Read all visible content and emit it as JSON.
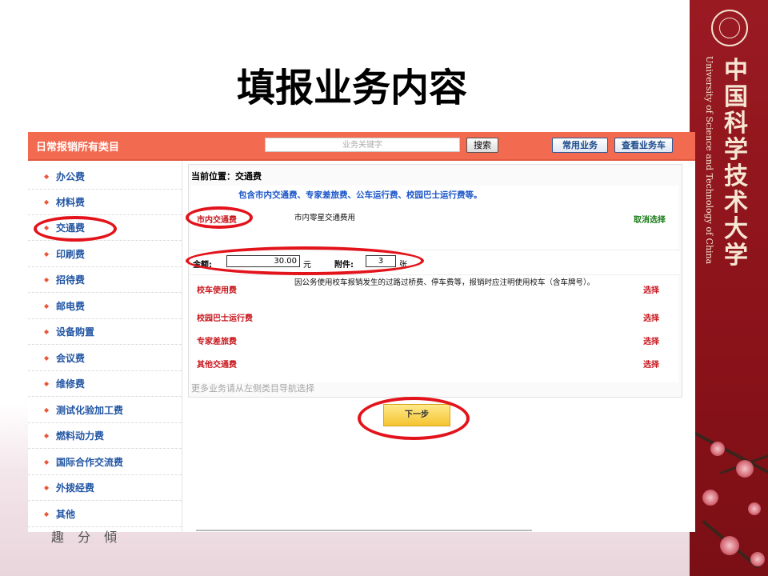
{
  "slide": {
    "title": "填报业务内容",
    "university_cn": "中国科学技术大学",
    "university_en": "University of Science and Technology of China",
    "partial_text": "趣 分 傾"
  },
  "app": {
    "header": {
      "title": "日常报销所有类目",
      "search_placeholder": "业务关键字",
      "search_button": "搜索",
      "common_button": "常用业务",
      "cart_button": "查看业务车"
    },
    "sidebar": {
      "items": [
        {
          "label": "办公费"
        },
        {
          "label": "材料费"
        },
        {
          "label": "交通费",
          "active": true
        },
        {
          "label": "印刷费"
        },
        {
          "label": "招待费"
        },
        {
          "label": "邮电费"
        },
        {
          "label": "设备购置"
        },
        {
          "label": "会议费"
        },
        {
          "label": "维修费"
        },
        {
          "label": "测试化验加工费"
        },
        {
          "label": "燃料动力费"
        },
        {
          "label": "国际合作交流费"
        },
        {
          "label": "外拨经费"
        },
        {
          "label": "其他"
        }
      ]
    },
    "main": {
      "location": "当前位置：交通费",
      "description": "包含市内交通费、专家差旅费、公车运行费、校园巴士运行费等。",
      "selected": {
        "name": "市内交通费",
        "desc": "市内零星交通费用",
        "action": "取消选择"
      },
      "amount": {
        "amount_label": "金额:",
        "amount_value": "30.00",
        "amount_unit": "元",
        "attach_label": "附件:",
        "attach_value": "3",
        "attach_unit": "张"
      },
      "rows": [
        {
          "name": "校车使用费",
          "desc": "因公务使用校车报销发生的过路过桥费、停车费等，报销时应注明使用校车（含车牌号）。",
          "action": "选择"
        },
        {
          "name": "校园巴士运行费",
          "desc": "",
          "action": "选择"
        },
        {
          "name": "专家差旅费",
          "desc": "",
          "action": "选择"
        },
        {
          "name": "其他交通费",
          "desc": "",
          "action": "选择"
        }
      ],
      "more_text": "更多业务请从左侧类目导航选择",
      "next_button": "下一步"
    }
  },
  "colors": {
    "header_bg": "#f26a4f",
    "link_blue": "#2155a4",
    "item_red": "#c8161d",
    "highlight_ring": "#e3131b",
    "band_red": "#8a1219",
    "cancel_green": "#1a7a1a"
  },
  "icons": {
    "sidebar_bullet": "diamond-bullet-icon",
    "emblem": "university-emblem-icon"
  }
}
